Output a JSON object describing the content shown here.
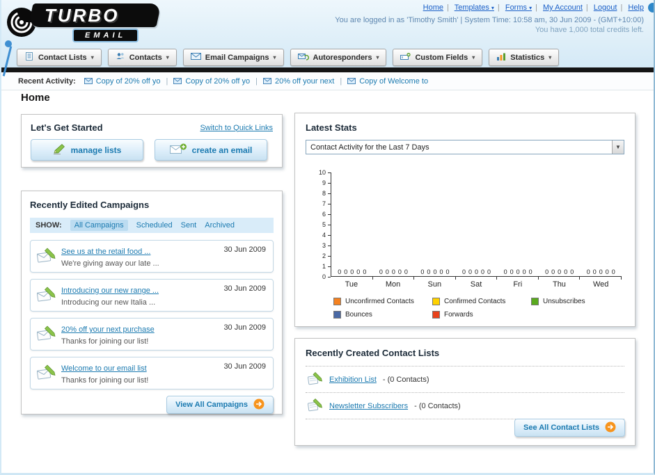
{
  "colors": {
    "link": "#1b7ab0",
    "accent_orange": "#f7941d"
  },
  "header": {
    "logo": {
      "title": "TURBO",
      "subtitle": "EMAIL"
    },
    "nav": [
      {
        "label": "Home",
        "dropdown": false
      },
      {
        "label": "Templates",
        "dropdown": true
      },
      {
        "label": "Forms",
        "dropdown": true
      },
      {
        "label": "My Account",
        "dropdown": false
      },
      {
        "label": "Logout",
        "dropdown": false
      },
      {
        "label": "Help",
        "dropdown": false
      }
    ],
    "login_line": "You are logged in as 'Timothy Smith' | System Time: 10:58 am, 30 Jun 2009 - (GMT+10:00)",
    "credits_line": "You have 1,000 total credits left."
  },
  "tabs": [
    {
      "label": "Contact Lists",
      "icon": "contact-lists-icon"
    },
    {
      "label": "Contacts",
      "icon": "contacts-icon"
    },
    {
      "label": "Email Campaigns",
      "icon": "email-campaigns-icon"
    },
    {
      "label": "Autoresponders",
      "icon": "autoresponders-icon"
    },
    {
      "label": "Custom Fields",
      "icon": "custom-fields-icon"
    },
    {
      "label": "Statistics",
      "icon": "statistics-icon"
    }
  ],
  "recent_activity": {
    "label": "Recent Activity:",
    "items": [
      "Copy of 20% off yo",
      "Copy of 20% off yo",
      "20% off your next",
      "Copy of Welcome to"
    ]
  },
  "page_title": "Home",
  "get_started": {
    "title": "Let's Get Started",
    "switch_link_label": "Switch to Quick Links",
    "manage_lists_label": "manage lists",
    "create_email_label": "create an email"
  },
  "campaigns": {
    "title": "Recently Edited Campaigns",
    "show_label": "SHOW:",
    "filters": [
      "All Campaigns",
      "Scheduled",
      "Sent",
      "Archived"
    ],
    "active_filter": "All Campaigns",
    "view_all_label": "View All Campaigns",
    "items": [
      {
        "title": "See us at the retail food ...",
        "subtitle": "We're giving away our late ...",
        "date": "30 Jun 2009"
      },
      {
        "title": "Introducing our new range ...",
        "subtitle": "Introducing our new Italia ...",
        "date": "30 Jun 2009"
      },
      {
        "title": "20% off your next purchase",
        "subtitle": "Thanks for joining our list!",
        "date": "30 Jun 2009"
      },
      {
        "title": "Welcome to our email list",
        "subtitle": "Thanks for joining our list!",
        "date": "30 Jun 2009"
      }
    ]
  },
  "stats": {
    "title": "Latest Stats",
    "selector_value": "Contact Activity for the Last 7 Days",
    "chart_data": {
      "type": "bar",
      "title": "Contact Activity for the Last 7 Days",
      "categories": [
        "Tue",
        "Mon",
        "Sun",
        "Sat",
        "Fri",
        "Thu",
        "Wed"
      ],
      "series": [
        {
          "name": "Unconfirmed Contacts",
          "color": "#f58220",
          "values": [
            0,
            0,
            0,
            0,
            0,
            0,
            0
          ]
        },
        {
          "name": "Confirmed Contacts",
          "color": "#ffd200",
          "values": [
            0,
            0,
            0,
            0,
            0,
            0,
            0
          ]
        },
        {
          "name": "Unsubscribes",
          "color": "#5aaa1e",
          "values": [
            0,
            0,
            0,
            0,
            0,
            0,
            0
          ]
        },
        {
          "name": "Bounces",
          "color": "#4a69a5",
          "values": [
            0,
            0,
            0,
            0,
            0,
            0,
            0
          ]
        },
        {
          "name": "Forwards",
          "color": "#e8421c",
          "values": [
            0,
            0,
            0,
            0,
            0,
            0,
            0
          ]
        }
      ],
      "ylim": [
        0,
        10
      ],
      "ytick_step": 1,
      "grid": false,
      "legend_position": "bottom"
    }
  },
  "contact_lists": {
    "title": "Recently Created Contact Lists",
    "items": [
      {
        "name": "Exhibition List",
        "detail": "- (0 Contacts)"
      },
      {
        "name": "Newsletter Subscribers",
        "detail": "- (0 Contacts)"
      }
    ],
    "see_all_label": "See All Contact Lists"
  }
}
